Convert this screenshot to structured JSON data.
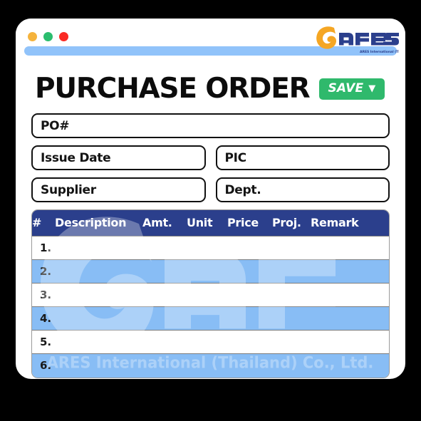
{
  "window": {
    "dots": [
      {
        "name": "minimize-dot",
        "color": "#f5b33c"
      },
      {
        "name": "maximize-dot",
        "color": "#2bbd6e"
      },
      {
        "name": "close-dot",
        "color": "#fa2a24"
      }
    ],
    "addressbar_value": ""
  },
  "brand": {
    "name": "ares",
    "tagline": "ARES International (Thailand) Co., Ltd.",
    "mark_color": "#f5a623",
    "text_color": "#2b3f8c"
  },
  "header": {
    "title": "PURCHASE ORDER",
    "save_label": "SAVE",
    "save_caret": "▼",
    "save_color": "#2fb96c"
  },
  "form": {
    "rows": [
      [
        {
          "name": "po-number-field",
          "label": "PO#",
          "placeholder": "PO#",
          "value": ""
        }
      ],
      [
        {
          "name": "issue-date-field",
          "label": "Issue Date",
          "placeholder": "Issue Date",
          "value": ""
        },
        {
          "name": "pic-field",
          "label": "PIC",
          "placeholder": "PIC",
          "value": ""
        }
      ],
      [
        {
          "name": "supplier-field",
          "label": "Supplier",
          "placeholder": "Supplier",
          "value": ""
        },
        {
          "name": "dept-field",
          "label": "Dept.",
          "placeholder": "Dept.",
          "value": ""
        }
      ]
    ]
  },
  "table": {
    "header_color": "#2b3f8c",
    "stripe_color": "#88bdf5",
    "columns": [
      {
        "key": "num",
        "label": "#"
      },
      {
        "key": "desc",
        "label": "Description"
      },
      {
        "key": "amt",
        "label": "Amt."
      },
      {
        "key": "unit",
        "label": "Unit"
      },
      {
        "key": "price",
        "label": "Price"
      },
      {
        "key": "proj",
        "label": "Proj."
      },
      {
        "key": "rem",
        "label": "Remark"
      }
    ],
    "rows": [
      {
        "num": "1.",
        "desc": "",
        "amt": "",
        "unit": "",
        "price": "",
        "proj": "",
        "rem": ""
      },
      {
        "num": "2.",
        "desc": "",
        "amt": "",
        "unit": "",
        "price": "",
        "proj": "",
        "rem": ""
      },
      {
        "num": "3.",
        "desc": "",
        "amt": "",
        "unit": "",
        "price": "",
        "proj": "",
        "rem": ""
      },
      {
        "num": "4.",
        "desc": "",
        "amt": "",
        "unit": "",
        "price": "",
        "proj": "",
        "rem": ""
      },
      {
        "num": "5.",
        "desc": "",
        "amt": "",
        "unit": "",
        "price": "",
        "proj": "",
        "rem": ""
      },
      {
        "num": "6.",
        "desc": "",
        "amt": "",
        "unit": "",
        "price": "",
        "proj": "",
        "rem": ""
      }
    ]
  },
  "watermark": {
    "mark": "ares",
    "text": "ARES International (Thailand) Co., Ltd."
  }
}
